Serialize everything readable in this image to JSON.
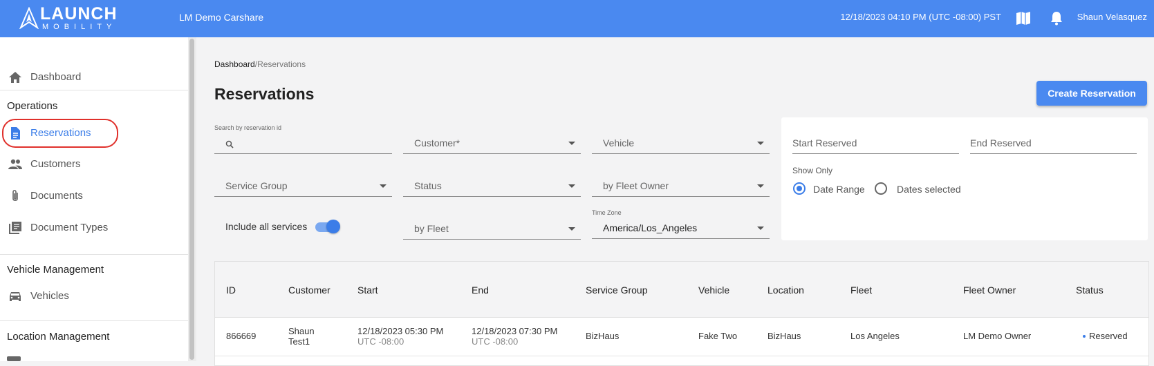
{
  "header": {
    "logo_main": "LAUNCH",
    "logo_sub": "MOBILITY",
    "app_name": "LM Demo Carshare",
    "datetime": "12/18/2023 04:10 PM (UTC -08:00) PST",
    "user_name": "Shaun Velasquez",
    "icons": [
      "book-map-icon",
      "bell-icon"
    ]
  },
  "sidebar": {
    "dashboard": "Dashboard",
    "sections": [
      {
        "title": "Operations",
        "items": [
          "Reservations",
          "Customers",
          "Documents",
          "Document Types"
        ]
      },
      {
        "title": "Vehicle Management",
        "items": [
          "Vehicles"
        ]
      },
      {
        "title": "Location Management",
        "items": []
      }
    ],
    "active_item": "Reservations"
  },
  "breadcrumb": {
    "root": "Dashboard",
    "separator": "/",
    "current": "Reservations"
  },
  "page_title": "Reservations",
  "create_button": "Create Reservation",
  "filters": {
    "search_label": "Search by reservation id",
    "search_value": "",
    "customer": "Customer*",
    "vehicle": "Vehicle",
    "service_group": "Service Group",
    "status": "Status",
    "fleet_owner": "by Fleet Owner",
    "include_all_services": "Include all services",
    "include_all_services_on": true,
    "fleet": "by Fleet",
    "timezone_label": "Time Zone",
    "timezone_value": "America/Los_Angeles"
  },
  "date_filter": {
    "start": "Start Reserved",
    "end": "End Reserved",
    "show_only": "Show Only",
    "options": [
      "Date Range",
      "Dates selected"
    ],
    "selected": "Date Range"
  },
  "table": {
    "columns": [
      "ID",
      "Customer",
      "Start",
      "End",
      "Service Group",
      "Vehicle",
      "Location",
      "Fleet",
      "Fleet Owner",
      "Status"
    ],
    "rows": [
      {
        "id": "866669",
        "customer_line1": "Shaun",
        "customer_line2": "Test1",
        "start_date": "12/18/2023 05:30 PM",
        "start_tz": "UTC -08:00",
        "end_date": "12/18/2023 07:30 PM",
        "end_tz": "UTC -08:00",
        "service_group": "BizHaus",
        "vehicle": "Fake Two",
        "location": "BizHaus",
        "fleet": "Los Angeles",
        "fleet_owner": "LM Demo Owner",
        "status": "Reserved"
      }
    ]
  },
  "colors": {
    "primary": "#4a89f0",
    "accent": "#3b7de8",
    "highlight": "#e0302b"
  }
}
